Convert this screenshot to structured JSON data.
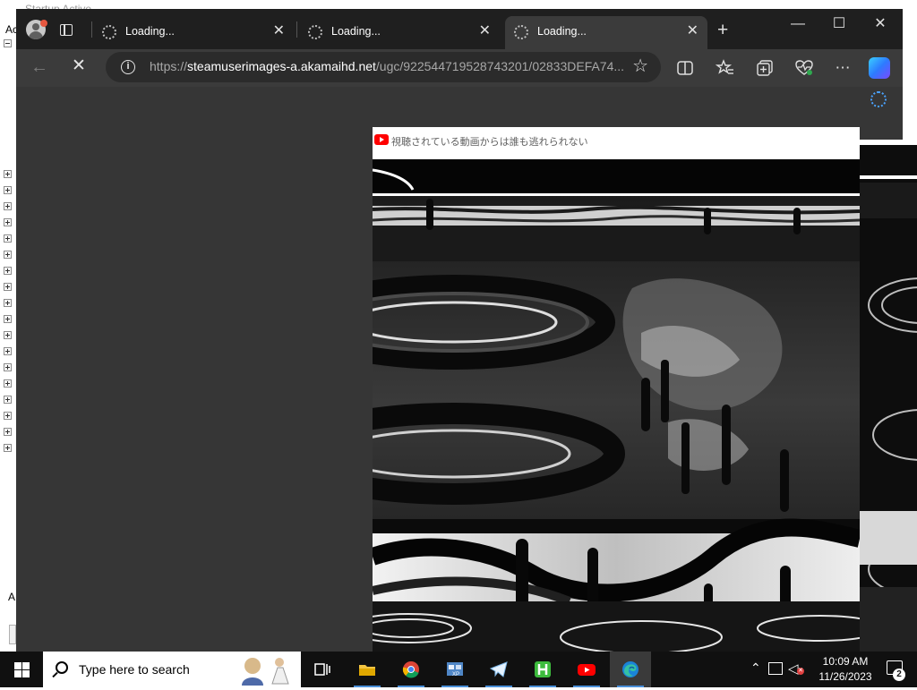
{
  "background_window": {
    "title": "Startup Active",
    "label_top": "Ac",
    "label_bottom": "A"
  },
  "browser": {
    "tabs": [
      {
        "label": "Loading...",
        "active": false
      },
      {
        "label": "Loading...",
        "active": false
      },
      {
        "label": "Loading...",
        "active": true
      }
    ],
    "new_tab_glyph": "+",
    "window_controls": {
      "minimize": "—",
      "maximize": "☐",
      "close": "✕"
    },
    "address_bar": {
      "scheme": "https://",
      "host": "steamuserimages-a.akamaihd.net",
      "path": "/ugc/922544719528743201/02833DEFA74..."
    },
    "icons": [
      "back-arrow-icon",
      "stop-icon",
      "info-icon",
      "favorite-star-icon",
      "split-screen-icon",
      "favorites-icon",
      "collections-icon",
      "browser-essentials-icon",
      "more-icon",
      "copilot-icon"
    ]
  },
  "video_popup": {
    "title": "視聴されている動画からは誰も逃れられない",
    "source_icon": "youtube-icon"
  },
  "taskbar": {
    "search_placeholder": "Type here to search",
    "apps": [
      "task-view-icon",
      "file-explorer-icon",
      "chrome-icon",
      "xp-app-icon",
      "telegram-icon",
      "h-app-icon",
      "youtube-icon",
      "edge-icon"
    ],
    "active_app": "edge-icon",
    "clock_time": "10:09 AM",
    "clock_date": "11/26/2023",
    "notification_count": "2"
  }
}
